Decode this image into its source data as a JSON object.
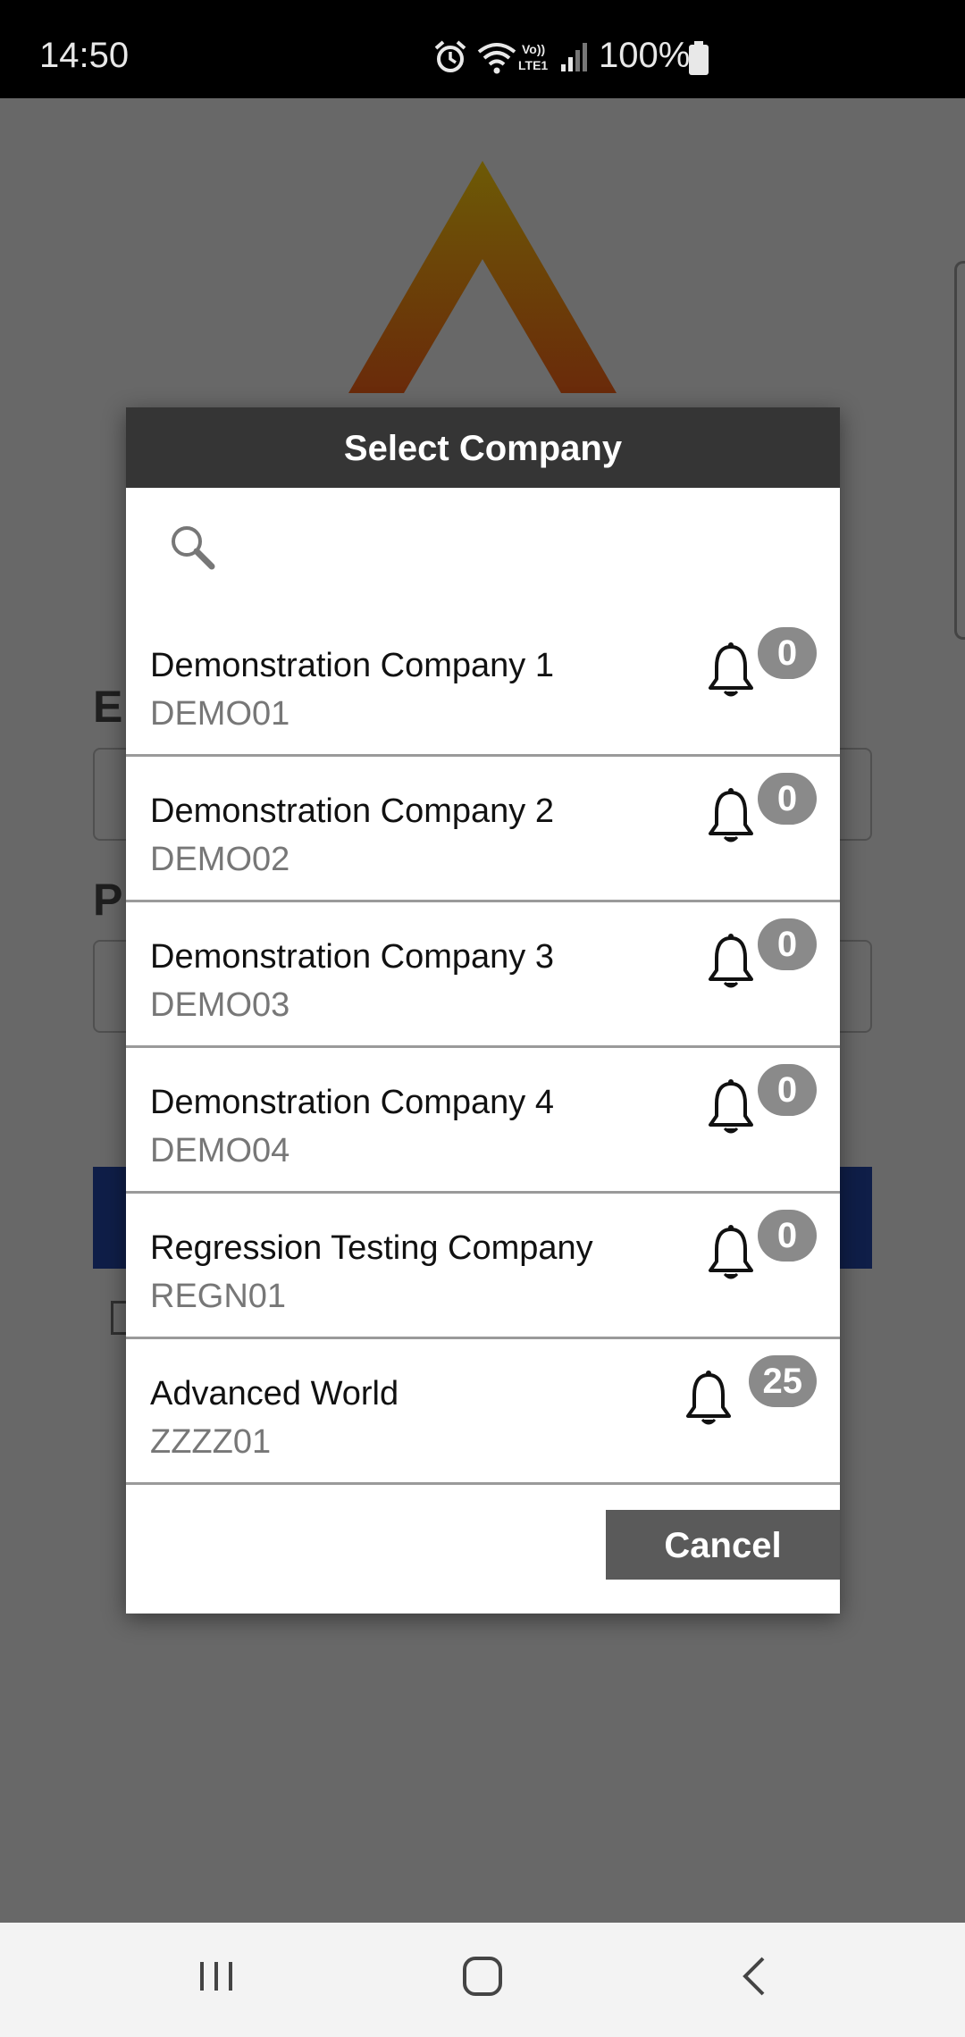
{
  "status_bar": {
    "time": "14:50",
    "battery": "100%",
    "icons": [
      "alarm-icon",
      "wifi-icon",
      "volte-icon",
      "signal-icon",
      "battery-icon"
    ]
  },
  "dialog": {
    "title": "Select Company",
    "search_icon": "search-icon",
    "items": [
      {
        "name": "Demonstration Company 1",
        "code": "DEMO01",
        "count": "0"
      },
      {
        "name": "Demonstration Company 2",
        "code": "DEMO02",
        "count": "0"
      },
      {
        "name": "Demonstration Company 3",
        "code": "DEMO03",
        "count": "0"
      },
      {
        "name": "Demonstration Company 4",
        "code": "DEMO04",
        "count": "0"
      },
      {
        "name": "Regression Testing Company",
        "code": "REGN01",
        "count": "0"
      },
      {
        "name": "Advanced World",
        "code": "ZZZZ01",
        "count": "25"
      }
    ],
    "cancel_label": "Cancel"
  },
  "background": {
    "label_1": "E",
    "label_2": "P"
  },
  "nav_bar": {
    "icons": [
      "recents-icon",
      "home-icon",
      "back-icon"
    ]
  },
  "colors": {
    "header": "#353535",
    "badge": "#8a8a8a",
    "cancel": "#5a5a5a",
    "overlay": "#686868"
  }
}
